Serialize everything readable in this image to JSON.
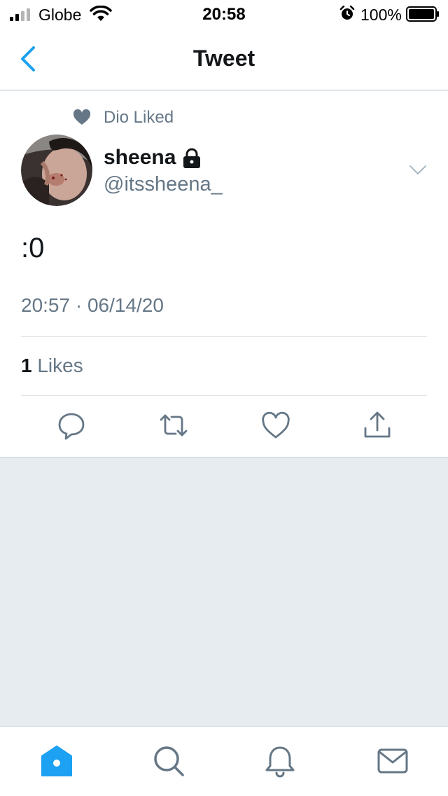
{
  "status_bar": {
    "carrier": "Globe",
    "time": "20:58",
    "battery": "100%"
  },
  "nav": {
    "title": "Tweet"
  },
  "tweet": {
    "social_context": "Dio Liked",
    "author": {
      "display_name": "sheena",
      "handle": "@itssheena_"
    },
    "text": ":0",
    "timestamp": "20:57 · 06/14/20",
    "likes_count": "1",
    "likes_label": "Likes"
  },
  "colors": {
    "accent": "#1da1f2",
    "muted": "#657786",
    "background": "#e6ecf0"
  },
  "icons": {
    "actions": [
      "reply-icon",
      "retweet-icon",
      "like-icon",
      "share-icon"
    ],
    "tabs": [
      "home-icon",
      "search-icon",
      "notifications-icon",
      "messages-icon"
    ]
  }
}
